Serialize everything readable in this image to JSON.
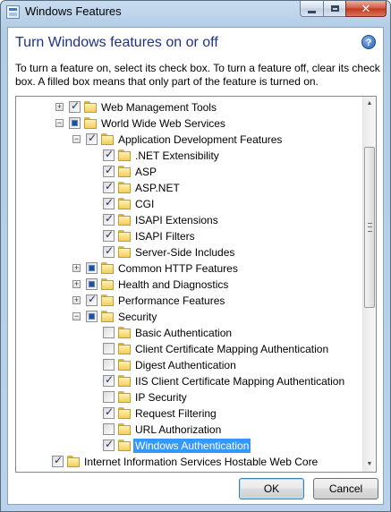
{
  "window": {
    "title": "Windows Features",
    "close_glyph": "✕",
    "icons": [
      "windows-features-icon",
      "minimize-icon",
      "maximize-icon",
      "close-icon"
    ]
  },
  "header": {
    "heading": "Turn Windows features on or off",
    "help_glyph": "?",
    "description": "To turn a feature on, select its check box. To turn a feature off, clear its check box. A filled box means that only part of the feature is turned on."
  },
  "tree": {
    "rows": [
      {
        "label": "Web Management Tools",
        "level": 1,
        "expander": "+",
        "state": "checked"
      },
      {
        "label": "World Wide Web Services",
        "level": 1,
        "expander": "−",
        "state": "partial"
      },
      {
        "label": "Application Development Features",
        "level": 2,
        "expander": "−",
        "state": "checked"
      },
      {
        "label": ".NET Extensibility",
        "level": 3,
        "expander": "",
        "state": "checked"
      },
      {
        "label": "ASP",
        "level": 3,
        "expander": "",
        "state": "checked"
      },
      {
        "label": "ASP.NET",
        "level": 3,
        "expander": "",
        "state": "checked"
      },
      {
        "label": "CGI",
        "level": 3,
        "expander": "",
        "state": "checked"
      },
      {
        "label": "ISAPI Extensions",
        "level": 3,
        "expander": "",
        "state": "checked"
      },
      {
        "label": "ISAPI Filters",
        "level": 3,
        "expander": "",
        "state": "checked"
      },
      {
        "label": "Server-Side Includes",
        "level": 3,
        "expander": "",
        "state": "checked"
      },
      {
        "label": "Common HTTP Features",
        "level": 2,
        "expander": "+",
        "state": "partial"
      },
      {
        "label": "Health and Diagnostics",
        "level": 2,
        "expander": "+",
        "state": "partial"
      },
      {
        "label": "Performance Features",
        "level": 2,
        "expander": "+",
        "state": "checked"
      },
      {
        "label": "Security",
        "level": 2,
        "expander": "−",
        "state": "partial"
      },
      {
        "label": "Basic Authentication",
        "level": 3,
        "expander": "",
        "state": "unchecked"
      },
      {
        "label": "Client Certificate Mapping Authentication",
        "level": 3,
        "expander": "",
        "state": "unchecked"
      },
      {
        "label": "Digest Authentication",
        "level": 3,
        "expander": "",
        "state": "unchecked"
      },
      {
        "label": "IIS Client Certificate Mapping Authentication",
        "level": 3,
        "expander": "",
        "state": "checked"
      },
      {
        "label": "IP Security",
        "level": 3,
        "expander": "",
        "state": "unchecked"
      },
      {
        "label": "Request Filtering",
        "level": 3,
        "expander": "",
        "state": "checked"
      },
      {
        "label": "URL Authorization",
        "level": 3,
        "expander": "",
        "state": "unchecked"
      },
      {
        "label": "Windows Authentication",
        "level": 3,
        "expander": "",
        "state": "checked",
        "selected": true
      },
      {
        "label": "Internet Information Services Hostable Web Core",
        "level": 0,
        "expander": "",
        "state": "checked"
      }
    ],
    "scrollbar": {
      "up_glyph": "▲",
      "down_glyph": "▼"
    }
  },
  "buttons": {
    "ok": "OK",
    "cancel": "Cancel"
  },
  "colors": {
    "heading": "#1e3287",
    "selection": "#3399ff",
    "partial_fill": "#204e97"
  }
}
